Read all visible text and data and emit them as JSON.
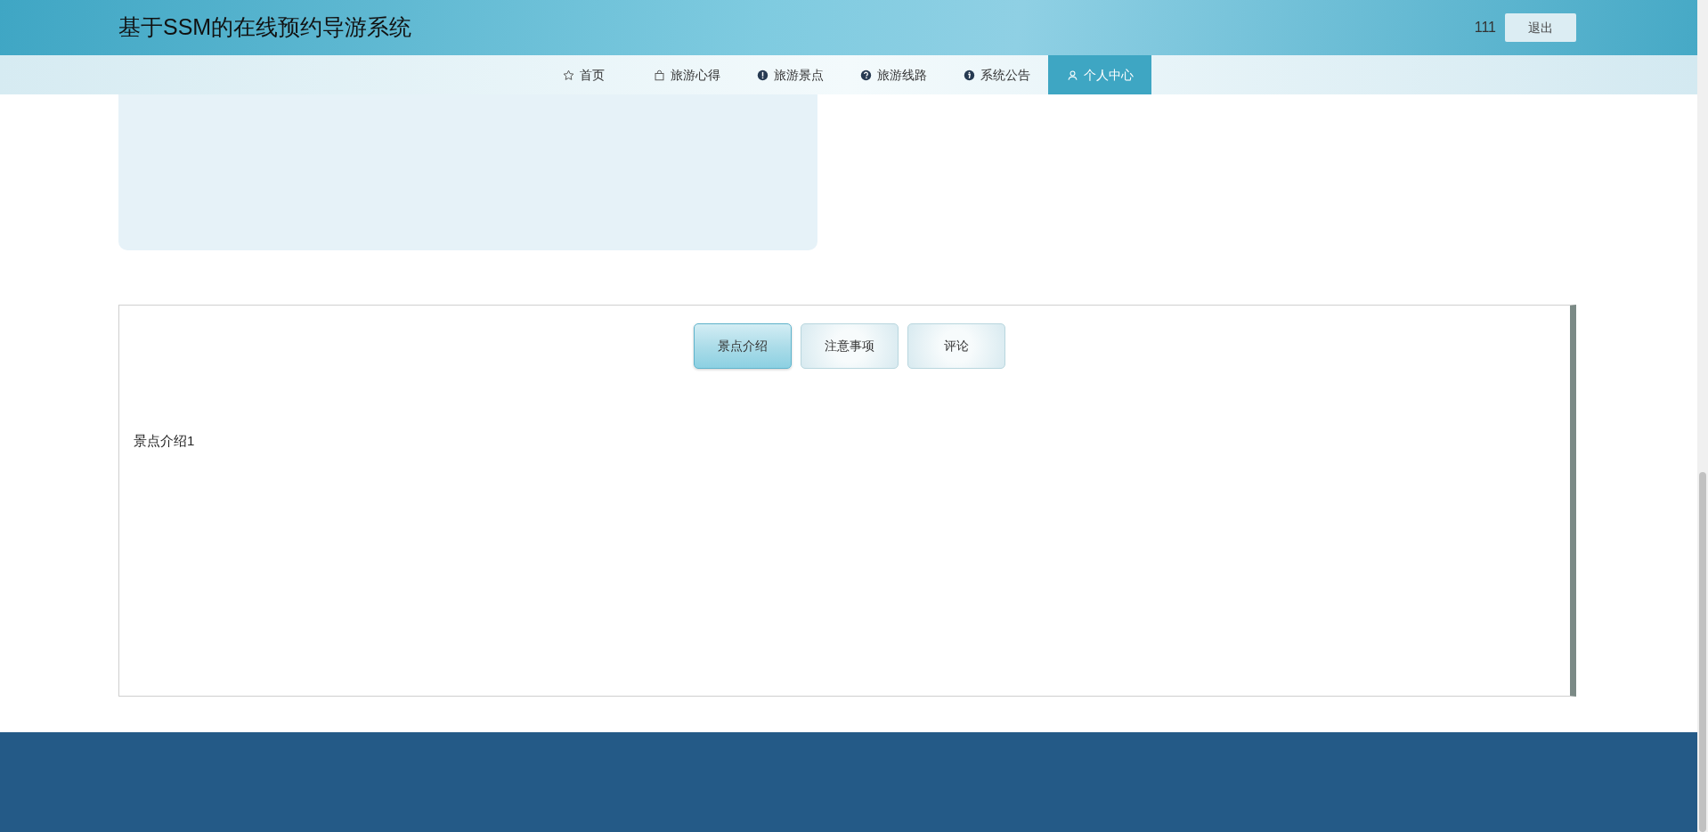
{
  "header": {
    "title": "基于SSM的在线预约导游系统",
    "username": "111",
    "logout_button": "退出"
  },
  "nav": [
    {
      "label": "首页",
      "selected": false
    },
    {
      "label": "旅游心得",
      "selected": false
    },
    {
      "label": "旅游景点",
      "selected": false
    },
    {
      "label": "旅游线路",
      "selected": false
    },
    {
      "label": "系统公告",
      "selected": false
    },
    {
      "label": "个人中心",
      "selected": true
    }
  ],
  "tabs": [
    {
      "label": "景点介绍",
      "selected": true
    },
    {
      "label": "注意事项",
      "selected": false
    },
    {
      "label": "评论",
      "selected": false
    }
  ],
  "content": "景点介绍1"
}
